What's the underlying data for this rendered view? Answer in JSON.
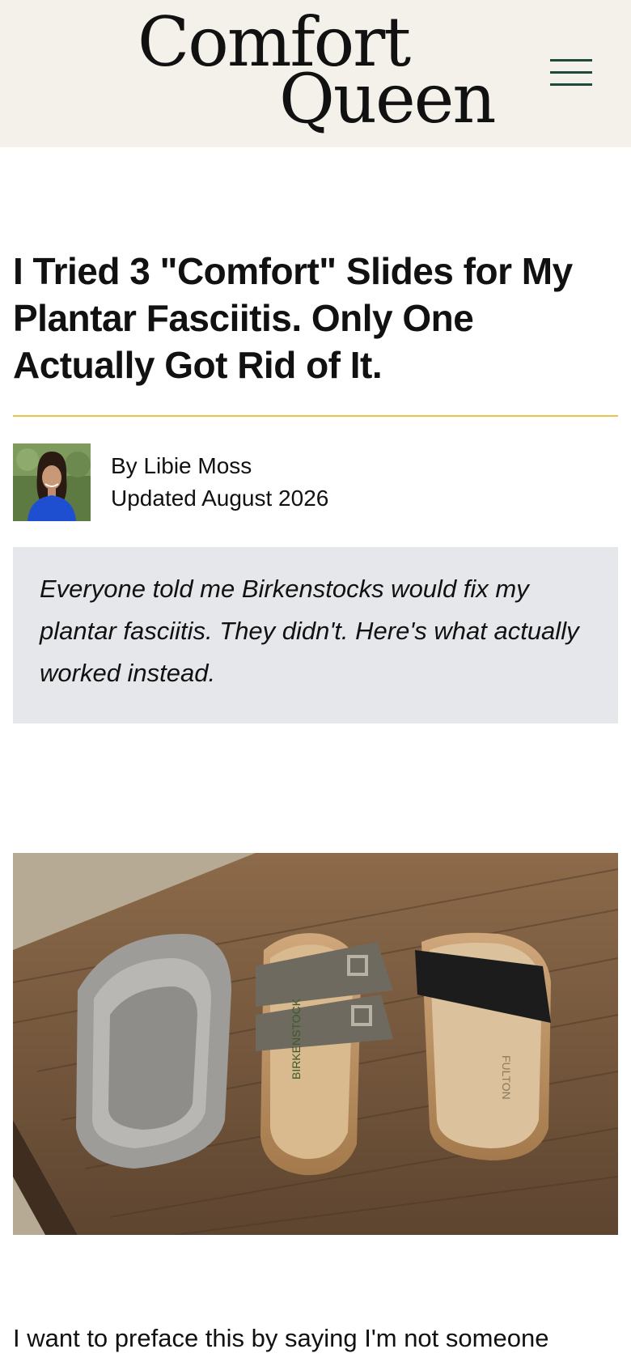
{
  "header": {
    "logo_line1": "Comfort",
    "logo_line2": "Queen",
    "menu_icon": "hamburger-menu-icon",
    "background": "#f3f1ea",
    "menu_color": "#1d4a3a"
  },
  "article": {
    "title": "I Tried 3 \"Comfort\" Slides for My Plantar Fasciitis. Only One Actually Got Rid of It.",
    "divider_color": "#e8c547",
    "author": "By Libie Moss",
    "updated": "Updated August 2026",
    "summary": "Everyone told me Birkenstocks would fix my plantar fasciitis. They didn't. Here's what actually worked instead.",
    "hero_image": {
      "sandal_labels": [
        "BIRKENSTOCK",
        "FULTON"
      ]
    },
    "body_first_line": "I want to preface this by saying I'm not someone"
  }
}
